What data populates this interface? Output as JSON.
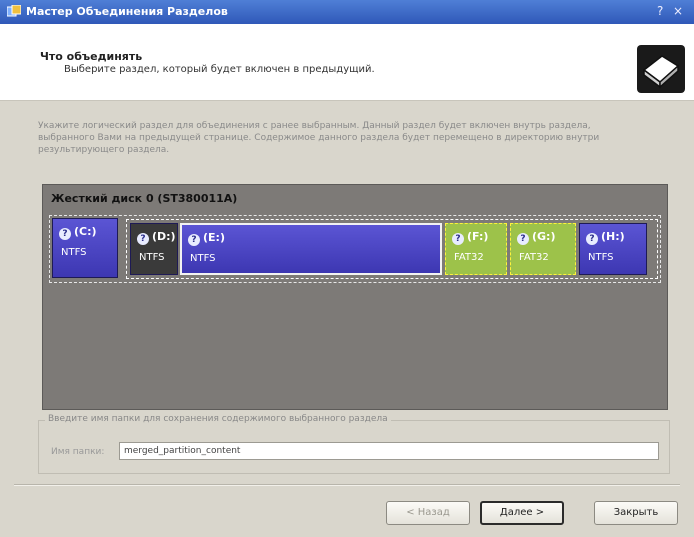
{
  "window": {
    "title": "Мастер Объединения Разделов",
    "help": "?",
    "close": "×"
  },
  "header": {
    "title": "Что объединять",
    "subtitle": "Выберите раздел, который будет включен в предыдущий."
  },
  "description": "Укажите логический раздел для объединения с ранее выбранным. Данный раздел будет включен внутрь раздела, выбранного Вами на предыдущей странице. Содержимое данного раздела будет перемещено в директорию внутри результирующего раздела.",
  "disk": {
    "label": "Жесткий диск 0 (ST380011A)",
    "partitions": [
      {
        "name": "(C:)",
        "fs": "NTFS"
      },
      {
        "name": "(D:)",
        "fs": "NTFS"
      },
      {
        "name": "(E:)",
        "fs": "NTFS"
      },
      {
        "name": "(F:)",
        "fs": "FAT32"
      },
      {
        "name": "(G:)",
        "fs": "FAT32"
      },
      {
        "name": "(H:)",
        "fs": "NTFS"
      }
    ],
    "help_glyph": "?"
  },
  "folder": {
    "legend": "Введите имя папки для сохранения содержимого выбранного раздела",
    "label": "Имя папки:",
    "value": "merged_partition_content"
  },
  "buttons": {
    "back": "< Назад",
    "next": "Далее >",
    "close": "Закрыть"
  },
  "colors": {
    "partition_blue": "#4a44c6",
    "partition_dark": "#3a3a3a",
    "partition_green": "#9dc24a",
    "titlebar": "#3a66c6"
  }
}
